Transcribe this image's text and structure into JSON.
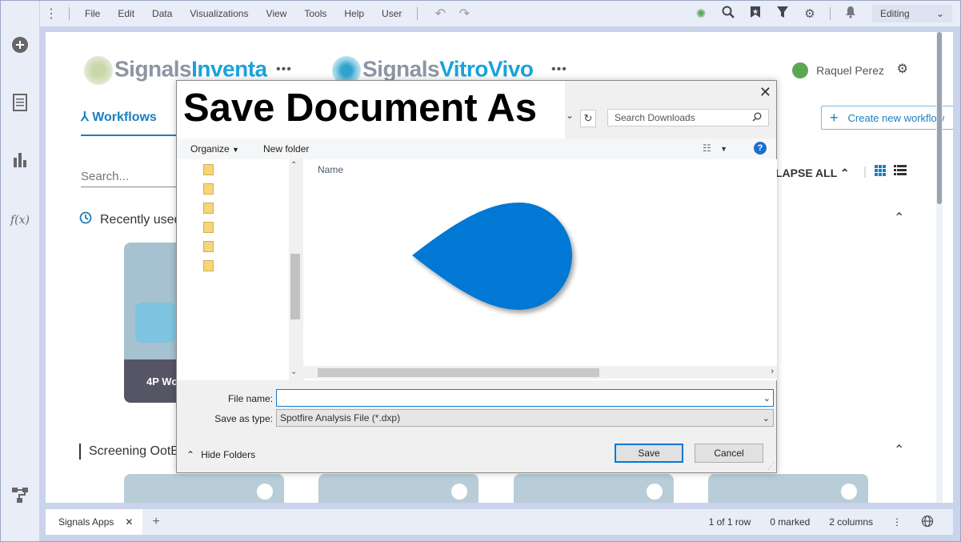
{
  "menubar": {
    "items": [
      "File",
      "Edit",
      "Data",
      "Visualizations",
      "View",
      "Tools",
      "Help",
      "User"
    ],
    "mode": "Editing"
  },
  "header": {
    "logo1_a": "Signals",
    "logo1_b": "Inventa",
    "logo2_a": "Signals",
    "logo2_b": "VitroVivo",
    "more": "•••",
    "user_name": "Raquel Perez",
    "workflows_tab": "Workflows",
    "create_workflow": "Create new workflow",
    "search_placeholder": "Search...",
    "collapse_all": "LAPSE ALL",
    "recently_used": "Recently used",
    "screening": "Screening OotB",
    "card_label": "4P Wo"
  },
  "bottombar": {
    "tab_label": "Signals Apps",
    "rows": "1 of 1 row",
    "marked": "0 marked",
    "columns": "2 columns"
  },
  "dialog": {
    "title": "Save Document As",
    "search_placeholder": "Search Downloads",
    "organize": "Organize",
    "new_folder": "New folder",
    "name_header": "Name",
    "file_name_label": "File name:",
    "file_name_value": "",
    "save_type_label": "Save as type:",
    "save_type_value": "Spotfire Analysis File (*.dxp)",
    "hide_folders": "Hide Folders",
    "save": "Save",
    "cancel": "Cancel"
  },
  "colors": {
    "accent": "#1a7fbd",
    "dialog_focus": "#0078d7",
    "cursor": "#0078d4"
  }
}
